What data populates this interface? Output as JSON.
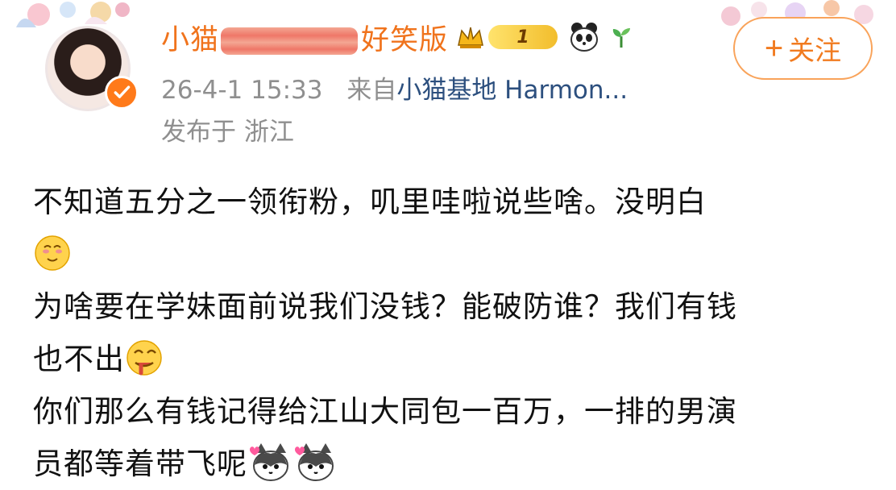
{
  "header": {
    "username_start": "小猫",
    "username_end": "好笑版",
    "level": "1",
    "timestamp": "26-4-1 15:33",
    "source_prefix": "来自",
    "source": "小猫基地 Harmon...",
    "location": "发布于 浙江"
  },
  "follow": {
    "plus": "+",
    "label": "关注"
  },
  "content": {
    "line1": "不知道五分之一领衔粉，叽里哇啦说些啥。没明白",
    "line2": "为啥要在学妹面前说我们没钱？能破防谁？我们有钱",
    "line3": "也不出",
    "line4": "你们那么有钱记得给江山大同包一百万，一排的男演",
    "line5": "员都等着带飞呢"
  },
  "icons": [
    "avatar",
    "crown-icon",
    "level-badge",
    "panda-icon",
    "sprout-icon",
    "blush-emoji",
    "drool-emoji",
    "cat-emoji"
  ],
  "colors": {
    "username": "#f0731c",
    "meta": "#8f8f8f",
    "source": "#2c4f7e",
    "follow_border": "#f9a35a"
  }
}
